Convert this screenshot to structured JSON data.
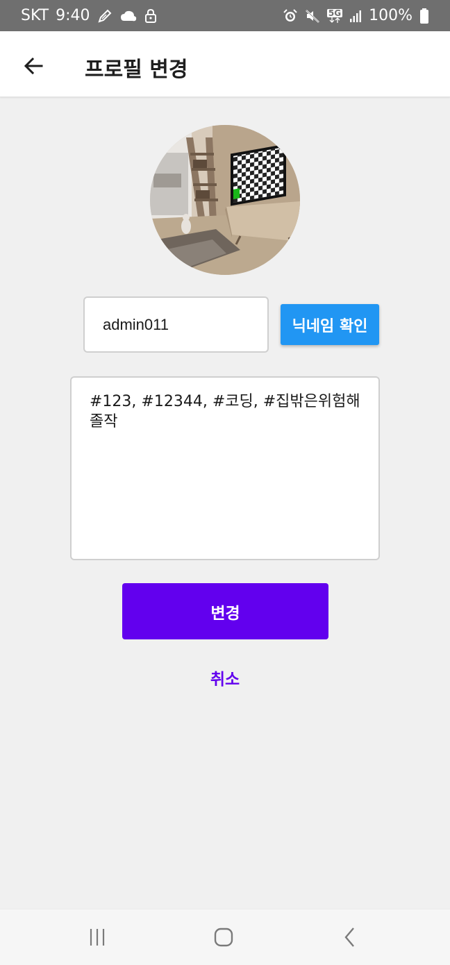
{
  "status_bar": {
    "carrier": "SKT",
    "time": "9:40",
    "network": "5G",
    "battery": "100%",
    "left_icons": [
      "pen-icon",
      "cloud-chat-icon",
      "lock-icon"
    ],
    "right_icons": [
      "alarm-icon",
      "mute-icon",
      "5g-icon",
      "signal-icon",
      "battery-icon"
    ]
  },
  "app_bar": {
    "title": "프로필 변경",
    "back_icon": "arrow-left-icon"
  },
  "profile": {
    "avatar_icon": "profile-photo"
  },
  "nickname": {
    "value": "admin011",
    "check_label": "닉네임 확인"
  },
  "bio": {
    "value": "#123, #12344, #코딩, #집밖은위험해\n졸작"
  },
  "actions": {
    "submit_label": "변경",
    "cancel_label": "취소"
  },
  "colors": {
    "primary": "#6200ee",
    "check_button": "#2196f3",
    "status_bar": "#6f6f6f",
    "background": "#f0f0f0"
  },
  "nav_bar": {
    "icons": [
      "recent-apps-icon",
      "home-icon",
      "back-icon"
    ]
  }
}
